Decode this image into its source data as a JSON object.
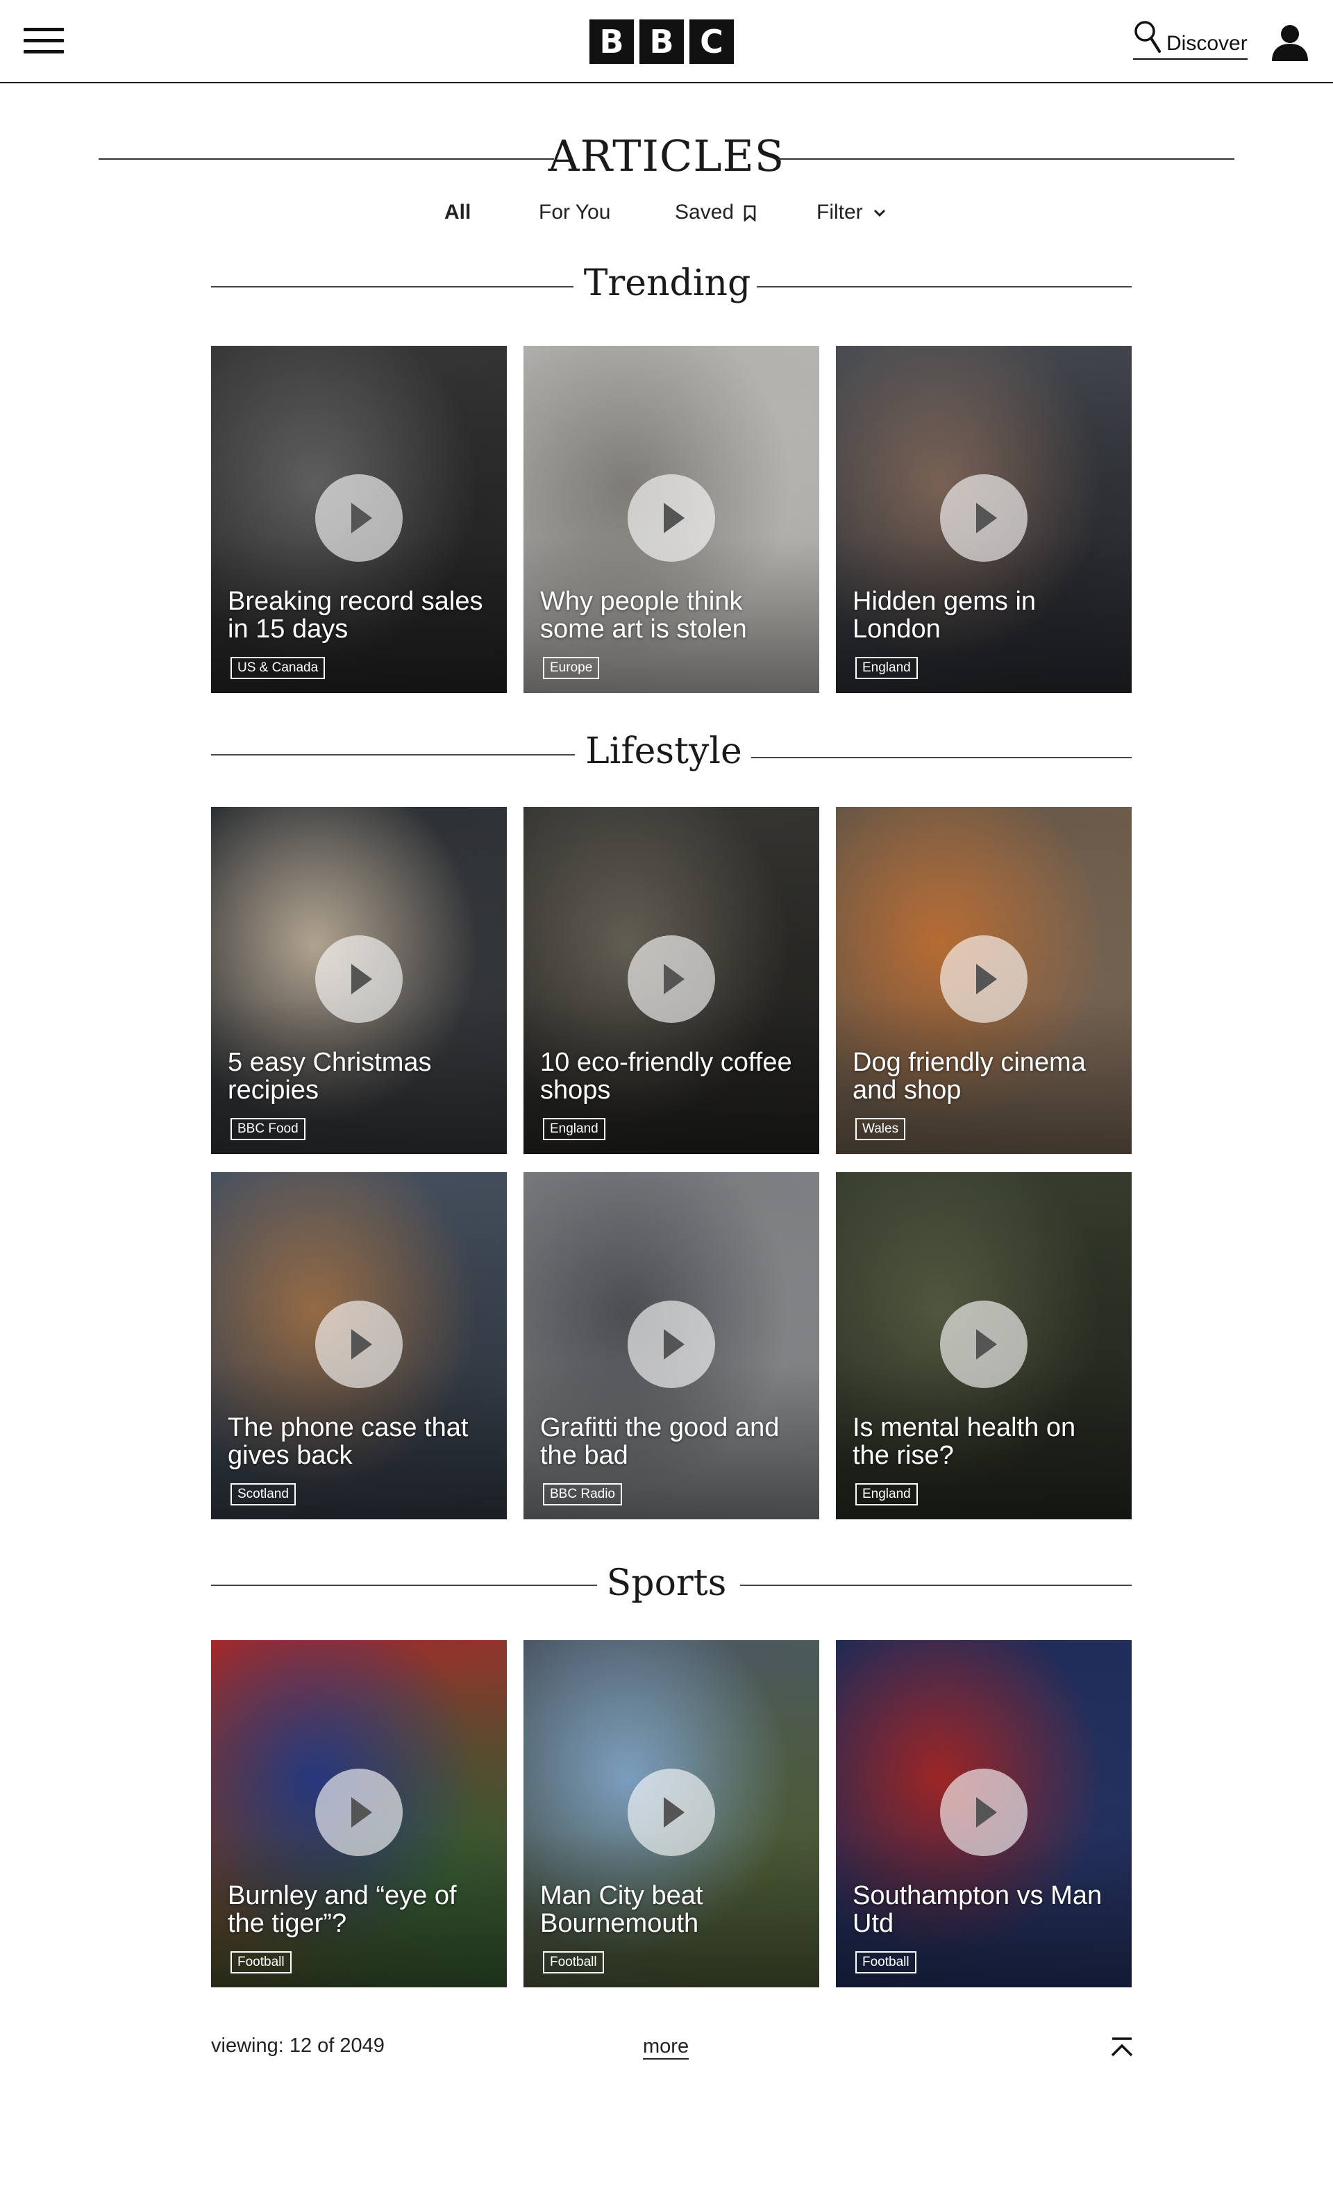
{
  "header": {
    "logo_letters": [
      "B",
      "B",
      "C"
    ],
    "discover_label": "Discover",
    "icons": [
      "hamburger-menu-icon",
      "search-icon",
      "user-icon"
    ]
  },
  "page": {
    "title": "ARTICLES",
    "tabs": [
      {
        "label": "All",
        "active": true
      },
      {
        "label": "For You",
        "active": false
      },
      {
        "label": "Saved",
        "active": false,
        "icon": "bookmark-icon"
      },
      {
        "label": "Filter",
        "active": false,
        "icon": "chevron-down-icon"
      }
    ]
  },
  "sections": [
    {
      "title": "Trending",
      "cards": [
        {
          "title": "Breaking record sales in 15 days",
          "tag": "US & Canada",
          "palette": [
            "#3a3a3a",
            "#6b6b6b",
            "#2a2a2a"
          ]
        },
        {
          "title": "Why people think some art is stolen",
          "tag": "Europe",
          "palette": [
            "#b9b7b3",
            "#8f8c87",
            "#d2d0cb"
          ]
        },
        {
          "title": "Hidden gems in London",
          "tag": "England",
          "palette": [
            "#4a4f56",
            "#8a6f60",
            "#2f3137"
          ]
        }
      ]
    },
    {
      "title": "Lifestyle",
      "cards": [
        {
          "title": "5 easy Christmas recipies",
          "tag": "BBC Food",
          "palette": [
            "#2e3236",
            "#c9b9a3",
            "#3d4044"
          ]
        },
        {
          "title": "10 eco-friendly coffee shops",
          "tag": "England",
          "palette": [
            "#3b3a36",
            "#6f6a5e",
            "#2a2926"
          ]
        },
        {
          "title": "Dog friendly cinema and shop",
          "tag": "Wales",
          "palette": [
            "#6b5a48",
            "#d07a3a",
            "#8a7561"
          ]
        },
        {
          "title": "The phone case that gives back",
          "tag": "Scotland",
          "palette": [
            "#4a5564",
            "#a9794e",
            "#3b4450"
          ]
        },
        {
          "title": "Grafitti the good and the bad",
          "tag": "BBC Radio",
          "palette": [
            "#7d7f82",
            "#55585c",
            "#9a9c9f"
          ]
        },
        {
          "title": "Is mental health on the rise?",
          "tag": "England",
          "palette": [
            "#3b4232",
            "#5c6247",
            "#2c3025"
          ]
        }
      ]
    },
    {
      "title": "Sports",
      "cards": [
        {
          "title": "Burnley and “eye of the tiger”?",
          "tag": "Football",
          "palette": [
            "#b02a2a",
            "#2b3f8f",
            "#3d6b3a"
          ]
        },
        {
          "title": "Man City beat Bournemouth",
          "tag": "Football",
          "palette": [
            "#4e5a6b",
            "#8cb3d9",
            "#5a6b3e"
          ]
        },
        {
          "title": "Southampton vs Man Utd",
          "tag": "Football",
          "palette": [
            "#1f2c5a",
            "#b22a2a",
            "#2b3a70"
          ]
        }
      ]
    }
  ],
  "footer": {
    "viewing_text": "viewing: 12 of 2049",
    "more_label": "more",
    "back_to_top_icon": "back-to-top-icon"
  }
}
